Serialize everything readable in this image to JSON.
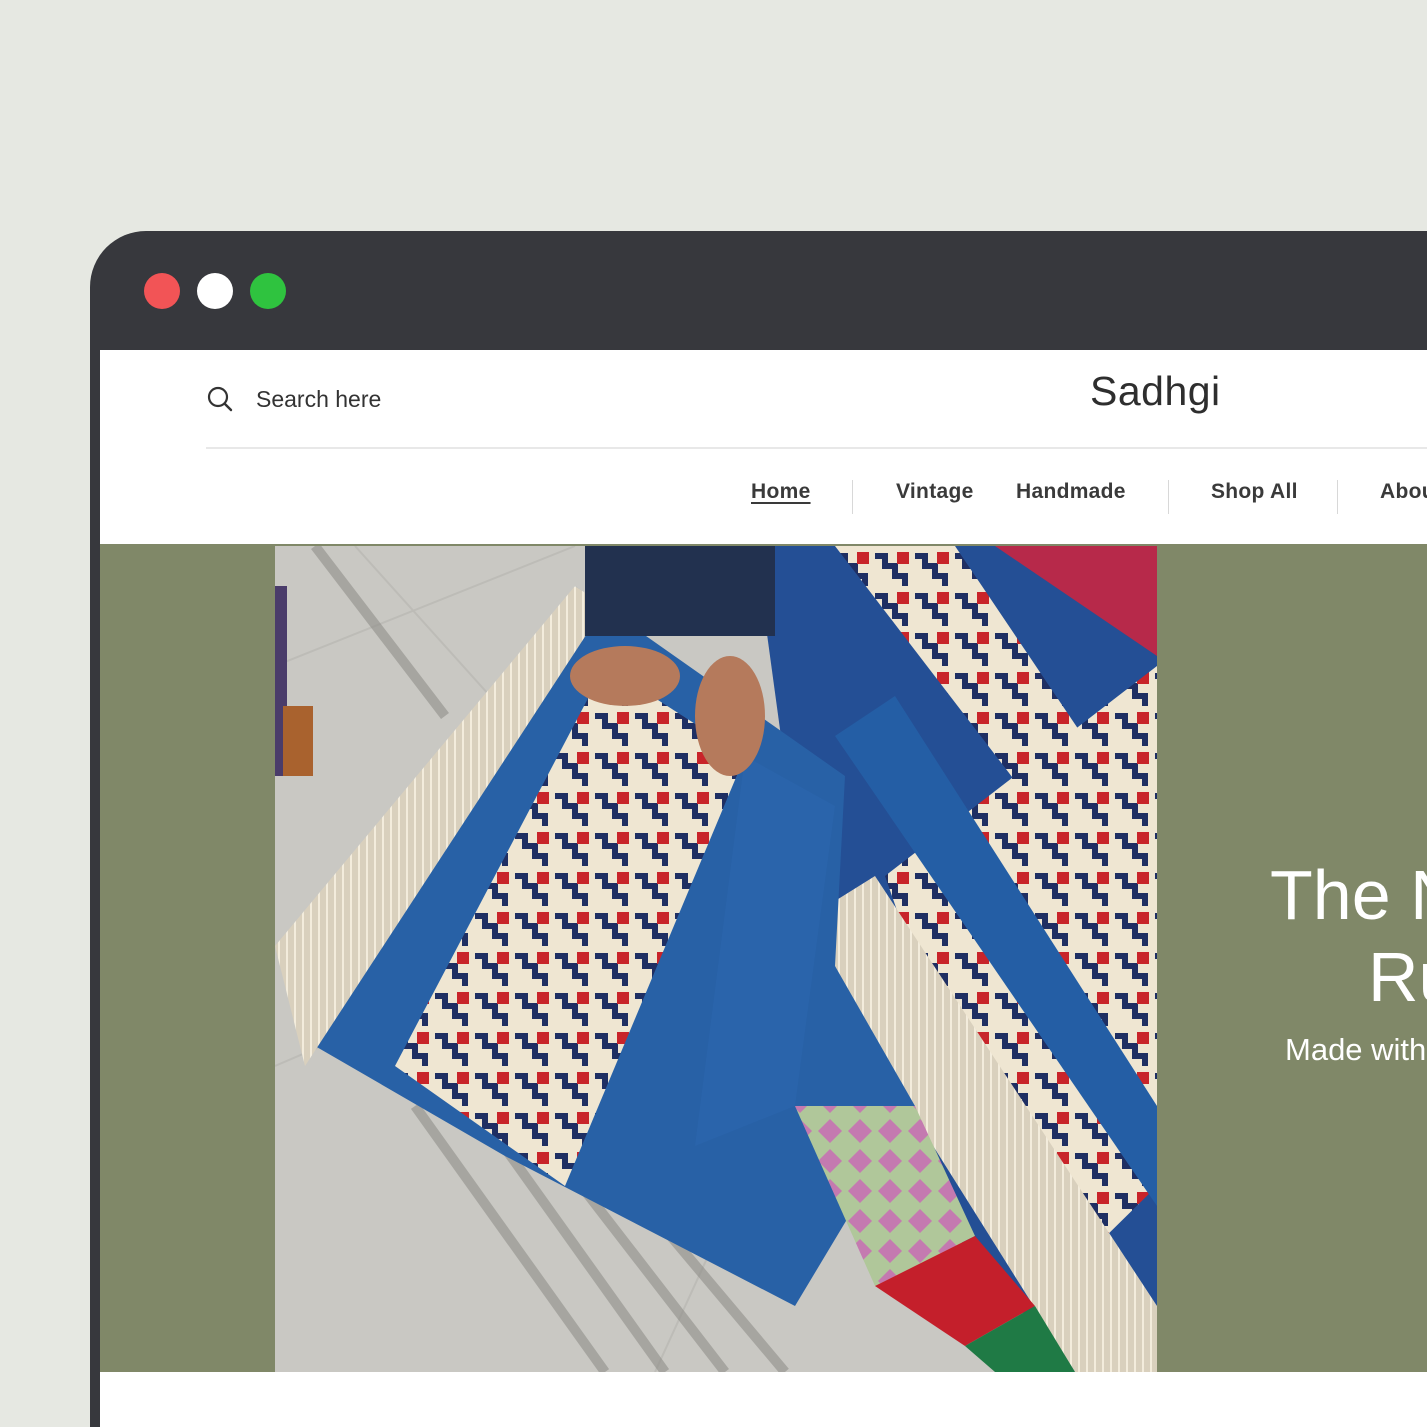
{
  "window": {
    "traffic_lights": [
      {
        "name": "close",
        "color": "#f25456"
      },
      {
        "name": "minimize",
        "color": "#ffffff"
      },
      {
        "name": "maximize",
        "color": "#2fc33f"
      }
    ],
    "chrome_color": "#37383d"
  },
  "header": {
    "search_placeholder": "Search here",
    "search_icon": "search-icon",
    "brand": "Sadhgi"
  },
  "nav": {
    "items": [
      {
        "label": "Home",
        "active": true
      },
      {
        "label": "Vintage",
        "active": false
      },
      {
        "label": "Handmade",
        "active": false
      },
      {
        "label": "Shop All",
        "active": false
      },
      {
        "label": "Abou",
        "active": false
      }
    ]
  },
  "hero": {
    "background_color": "#808868",
    "image_alt": "Colorful handwoven kilim rugs on a tiled floor",
    "heading_line1": "The N",
    "heading_line2": "Ru",
    "subheading": "Made with"
  }
}
